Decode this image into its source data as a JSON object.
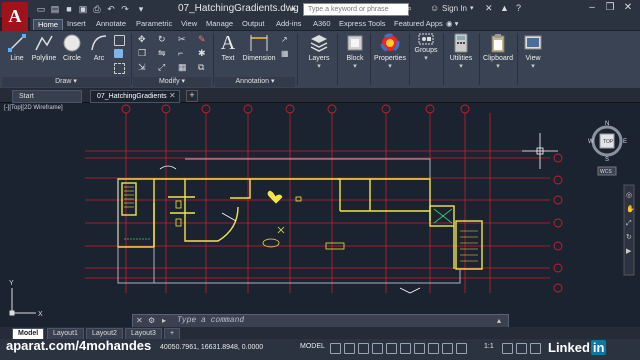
{
  "app": {
    "logo_letter": "A",
    "doc_title": "07_HatchingGradients.dwg",
    "search_placeholder": "Type a keyword or phrase",
    "signin_label": "Sign In"
  },
  "ribbon_tabs": [
    {
      "label": "Home",
      "active": true
    },
    {
      "label": "Insert"
    },
    {
      "label": "Annotate"
    },
    {
      "label": "Parametric"
    },
    {
      "label": "View"
    },
    {
      "label": "Manage"
    },
    {
      "label": "Output"
    },
    {
      "label": "Add-ins"
    },
    {
      "label": "A360"
    },
    {
      "label": "Express Tools"
    },
    {
      "label": "Featured Apps"
    }
  ],
  "ribbon": {
    "draw_tools": {
      "line": "Line",
      "polyline": "Polyline",
      "circle": "Circle",
      "arc": "Arc"
    },
    "panels": {
      "draw": "Draw",
      "modify": "Modify",
      "annotation": "Annotation"
    },
    "annotation_tools": {
      "text": "Text",
      "dimension": "Dimension"
    },
    "big_buttons": {
      "layers": "Layers",
      "block": "Block",
      "properties": "Properties",
      "groups": "Groups",
      "utilities": "Utilities",
      "clipboard": "Clipboard",
      "view": "View"
    }
  },
  "file_tabs": {
    "start": "Start",
    "current": "07_HatchingGradients",
    "add_symbol": "+"
  },
  "viewport": {
    "label": "[-][Top][2D Wireframe]"
  },
  "viewcube": {
    "top": "TOP",
    "n": "N",
    "s": "S",
    "e": "E",
    "w": "W",
    "wcs": "WCS"
  },
  "ucs": {
    "x": "X",
    "y": "Y"
  },
  "command": {
    "placeholder": "Type a command"
  },
  "layout_tabs": [
    {
      "label": "Model",
      "active": true
    },
    {
      "label": "Layout1"
    },
    {
      "label": "Layout2"
    },
    {
      "label": "Layout3"
    },
    {
      "label": "+"
    }
  ],
  "status": {
    "coords": "40050.7961, 16631.8948, 0.0000",
    "model_label": "MODEL",
    "scale": "1:1"
  },
  "watermark": {
    "text": "aparat.com/4mohandes",
    "brand": "Linked",
    "brand_in": "in"
  },
  "colors": {
    "accent_red": "#a0131b",
    "axis_red": "#c8202c",
    "wall_yellow": "#f0e64a",
    "background": "#1b2230"
  }
}
